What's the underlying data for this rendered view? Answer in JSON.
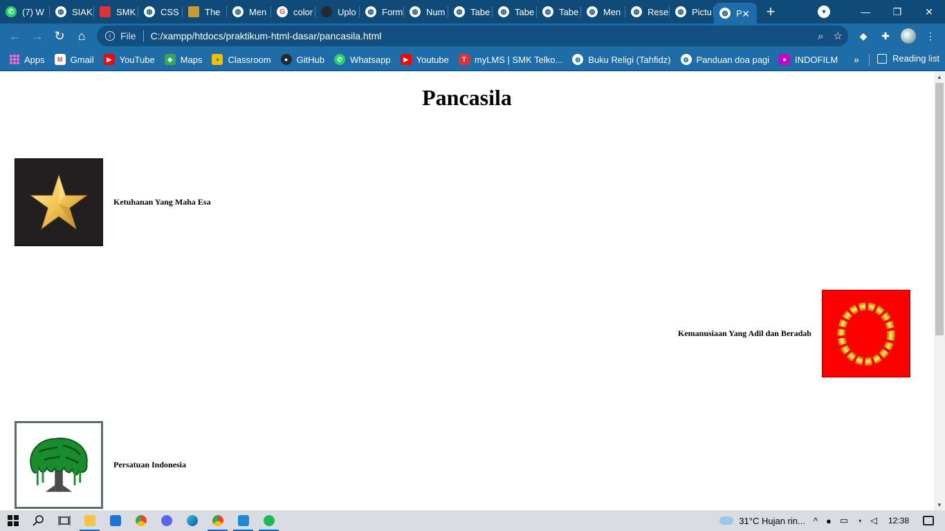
{
  "browser": {
    "tabs": [
      {
        "title": "(7) W",
        "icon": "whatsapp-icon"
      },
      {
        "title": "SIAK",
        "icon": "globe-icon"
      },
      {
        "title": "SMK",
        "icon": "smk-icon"
      },
      {
        "title": "CSS",
        "icon": "globe-icon"
      },
      {
        "title": "The",
        "icon": "shield-icon"
      },
      {
        "title": "Men",
        "icon": "globe-icon"
      },
      {
        "title": "color",
        "icon": "google-icon"
      },
      {
        "title": "Uplo",
        "icon": "github-icon"
      },
      {
        "title": "Form",
        "icon": "globe-icon"
      },
      {
        "title": "Num",
        "icon": "globe-icon"
      },
      {
        "title": "Tabe",
        "icon": "globe-icon"
      },
      {
        "title": "Tabe",
        "icon": "globe-icon"
      },
      {
        "title": "Tabe",
        "icon": "globe-icon"
      },
      {
        "title": "Men",
        "icon": "globe-icon"
      },
      {
        "title": "Rese",
        "icon": "globe-icon"
      },
      {
        "title": "Pictu",
        "icon": "globe-icon"
      },
      {
        "title": "P",
        "icon": "globe-icon",
        "active": true
      }
    ],
    "new_tab": "+",
    "address": {
      "scheme_label": "File",
      "url": "C:/xampp/htdocs/praktikum-html-dasar/pancasila.html"
    },
    "bookmarks": [
      {
        "label": "Apps",
        "icon": "apps-grid-icon"
      },
      {
        "label": "Gmail",
        "icon": "gmail-icon"
      },
      {
        "label": "YouTube",
        "icon": "youtube-icon"
      },
      {
        "label": "Maps",
        "icon": "maps-icon"
      },
      {
        "label": "Classroom",
        "icon": "classroom-icon"
      },
      {
        "label": "GitHub",
        "icon": "github-icon"
      },
      {
        "label": "Whatsapp",
        "icon": "whatsapp-icon"
      },
      {
        "label": "Youtube",
        "icon": "youtube-icon"
      },
      {
        "label": "myLMS | SMK Telko...",
        "icon": "lms-icon"
      },
      {
        "label": "Buku Religi (Tahfidz)",
        "icon": "globe-icon"
      },
      {
        "label": "Panduan doa pagi",
        "icon": "globe-icon"
      },
      {
        "label": "INDOFILM",
        "icon": "film-icon"
      }
    ],
    "more_bookmarks": "»",
    "reading_list": "Reading list"
  },
  "page": {
    "title": "Pancasila",
    "sila": [
      {
        "label": "Ketuhanan Yang Maha Esa",
        "emblem": "star-icon"
      },
      {
        "label": "Kemanusiaan Yang Adil dan Beradab",
        "emblem": "chain-icon"
      },
      {
        "label": "Persatuan Indonesia",
        "emblem": "banyan-tree-icon"
      }
    ]
  },
  "taskbar": {
    "weather": "31°C  Hujan rin...",
    "time": "12:38"
  },
  "colors": {
    "tabstrip": "#0f4a78",
    "toolbar": "#1f6da8",
    "star_bg": "#231f20",
    "chain_bg": "#ff0000",
    "tree_border": "#5a6b6b"
  }
}
